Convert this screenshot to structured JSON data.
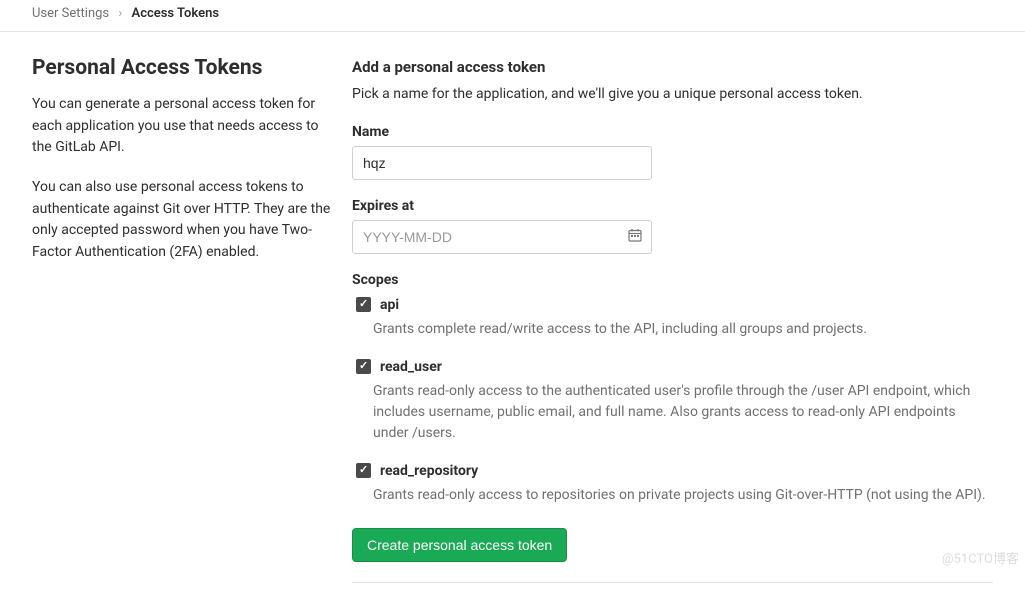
{
  "breadcrumb": {
    "parent": "User Settings",
    "current": "Access Tokens"
  },
  "sidebar": {
    "title": "Personal Access Tokens",
    "para1": "You can generate a personal access token for each application you use that needs access to the GitLab API.",
    "para2": "You can also use personal access tokens to authenticate against Git over HTTP. They are the only accepted password when you have Two-Factor Authentication (2FA) enabled."
  },
  "form": {
    "heading": "Add a personal access token",
    "intro": "Pick a name for the application, and we'll give you a unique personal access token.",
    "name_label": "Name",
    "name_value": "hqz",
    "expires_label": "Expires at",
    "expires_placeholder": "YYYY-MM-DD",
    "expires_value": "",
    "scopes_label": "Scopes",
    "scopes": [
      {
        "key": "api",
        "label": "api",
        "checked": true,
        "desc": "Grants complete read/write access to the API, including all groups and projects."
      },
      {
        "key": "read_user",
        "label": "read_user",
        "checked": true,
        "desc": "Grants read-only access to the authenticated user's profile through the /user API endpoint, which includes username, public email, and full name. Also grants access to read-only API endpoints under /users."
      },
      {
        "key": "read_repository",
        "label": "read_repository",
        "checked": true,
        "desc": "Grants read-only access to repositories on private projects using Git-over-HTTP (not using the API)."
      }
    ],
    "submit_label": "Create personal access token"
  },
  "watermark": "@51CTO博客"
}
